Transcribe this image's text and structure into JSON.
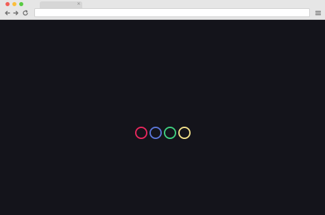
{
  "browser": {
    "tab": {
      "title": "",
      "close_label": "×"
    },
    "address_bar": {
      "value": ""
    },
    "icons": {
      "back": "arrow-left-icon",
      "forward": "arrow-right-icon",
      "reload": "reload-icon",
      "menu": "hamburger-menu-icon"
    },
    "window_controls": [
      "#f25f58",
      "#fbbe3b",
      "#58cb42"
    ]
  },
  "page": {
    "background_color": "#14141b",
    "loader": {
      "rings": [
        {
          "name": "ring-red",
          "color": "#e8275d"
        },
        {
          "name": "ring-blue",
          "color": "#5b76d8"
        },
        {
          "name": "ring-green",
          "color": "#3fcf7f"
        },
        {
          "name": "ring-yellow",
          "color": "#f2e08a"
        }
      ]
    }
  }
}
